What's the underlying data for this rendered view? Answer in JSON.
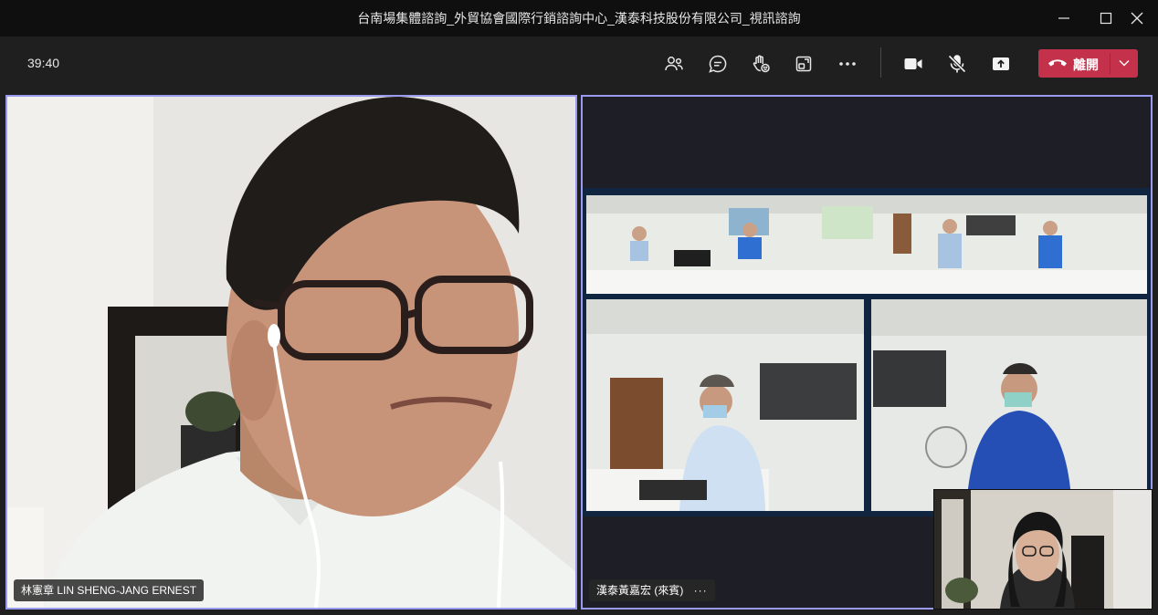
{
  "window": {
    "title": "台南場集體諮詢_外貿協會國際行銷諮詢中心_漢泰科技股份有限公司_視訊諮詢"
  },
  "toolbar": {
    "timer": "39:40",
    "icons": [
      "participants-icon",
      "chat-icon",
      "raise-hand-icon",
      "rooms-icon",
      "more-icon",
      "camera-icon",
      "mic-off-icon",
      "share-icon"
    ],
    "leave_label": "離開"
  },
  "videos": {
    "left_participant": "林憲章 LIN SHENG-JANG ERNEST",
    "right_participant": "漢泰黃嘉宏 (來賓)",
    "right_more": "···"
  },
  "colors": {
    "active_border": "#9a9af0",
    "leave_red": "#c4314b",
    "titlebar": "#0f0f0f",
    "toolbar": "#1f1f1f"
  }
}
